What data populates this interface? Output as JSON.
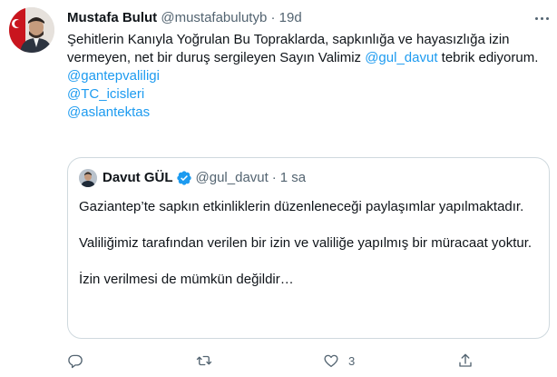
{
  "tweet": {
    "author_name": "Mustafa Bulut",
    "author_handle": "@mustafabulutyb",
    "separator": "·",
    "time": "19d",
    "text_line1": "Şehitlerin Kanıyla Yoğrulan Bu Topraklarda, sapkınlığa ve hayasızlığa izin vermeyen, net bir duruş sergileyen Sayın Valimiz ",
    "mention_inline": "@gul_davut",
    "text_line1_end": " tebrik ediyorum.",
    "mentions": [
      "@gantepvaliligi",
      "@TC_icisleri",
      "@aslantektas"
    ]
  },
  "quote": {
    "author_name": "Davut GÜL",
    "author_handle": "@gul_davut",
    "separator": "·",
    "time": "1 sa",
    "paragraphs": [
      "Gaziantep’te sapkın etkinliklerin düzenleneceği  paylaşımlar yapılmaktadır.",
      "Valiliğimiz tarafından verilen bir izin ve  valiliğe yapılmış bir müracaat yoktur.",
      "İzin verilmesi de mümkün değildir…"
    ]
  },
  "actions": {
    "reply_count": "",
    "retweet_count": "",
    "like_count": "3",
    "share_count": ""
  },
  "icons": [
    "more-icon",
    "verified-icon",
    "reply-icon",
    "retweet-icon",
    "like-icon",
    "share-icon"
  ],
  "colors": {
    "link": "#1d9bf0",
    "secondary_text": "#536471",
    "border": "#cfd9de",
    "verified": "#1d9bf0"
  }
}
